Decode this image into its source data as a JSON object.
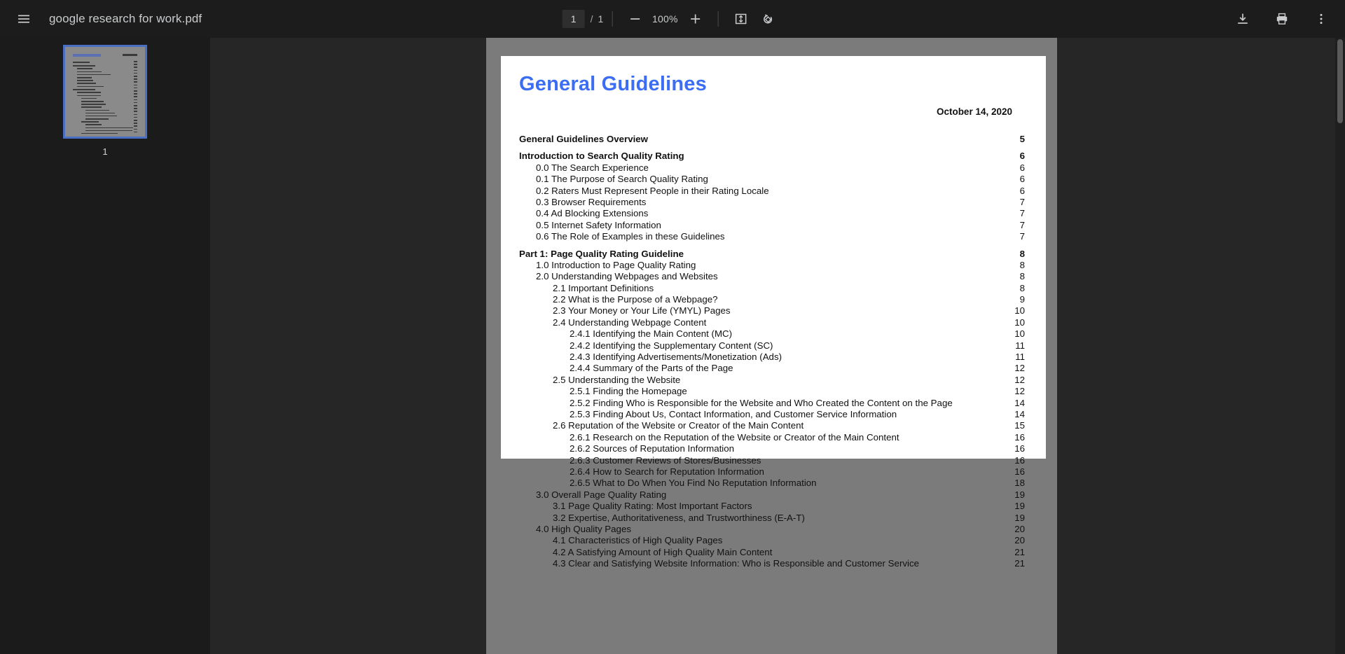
{
  "toolbar": {
    "menu_icon": "hamburger-menu-icon",
    "file_name": "google research for work.pdf",
    "page_current": "1",
    "page_separator": "/",
    "page_total": "1",
    "zoom_out_icon": "minus-icon",
    "zoom_level": "100%",
    "zoom_in_icon": "plus-icon",
    "fit_page_icon": "fit-to-page-icon",
    "rotate_icon": "rotate-counterclockwise-icon",
    "download_icon": "download-icon",
    "print_icon": "print-icon",
    "more_icon": "more-vertical-icon"
  },
  "sidebar": {
    "thumbnail_label": "1"
  },
  "document": {
    "title": "General Guidelines",
    "date": "October 14, 2020",
    "toc": [
      {
        "label": "General Guidelines Overview",
        "page": "5",
        "level": "h"
      },
      {
        "label": "Introduction to Search Quality Rating",
        "page": "6",
        "level": "h"
      },
      {
        "label": "0.0 The Search Experience",
        "page": "6",
        "level": "1"
      },
      {
        "label": "0.1 The Purpose of Search Quality Rating",
        "page": "6",
        "level": "1"
      },
      {
        "label": "0.2 Raters Must Represent People in their Rating Locale",
        "page": "6",
        "level": "1"
      },
      {
        "label": "0.3 Browser Requirements",
        "page": "7",
        "level": "1"
      },
      {
        "label": "0.4 Ad Blocking Extensions",
        "page": "7",
        "level": "1"
      },
      {
        "label": "0.5 Internet Safety Information",
        "page": "7",
        "level": "1"
      },
      {
        "label": "0.6 The Role of Examples in these Guidelines",
        "page": "7",
        "level": "1"
      },
      {
        "label": "Part 1: Page Quality Rating Guideline",
        "page": "8",
        "level": "h"
      },
      {
        "label": "1.0 Introduction to Page Quality Rating",
        "page": "8",
        "level": "1"
      },
      {
        "label": "2.0 Understanding Webpages and Websites",
        "page": "8",
        "level": "1"
      },
      {
        "label": "2.1 Important Definitions",
        "page": "8",
        "level": "2"
      },
      {
        "label": "2.2 What is the Purpose of a Webpage?",
        "page": "9",
        "level": "2"
      },
      {
        "label": "2.3 Your Money or Your Life (YMYL) Pages",
        "page": "10",
        "level": "2"
      },
      {
        "label": "2.4 Understanding Webpage Content",
        "page": "10",
        "level": "2"
      },
      {
        "label": "2.4.1 Identifying the Main Content (MC)",
        "page": "10",
        "level": "3"
      },
      {
        "label": "2.4.2 Identifying the Supplementary Content (SC)",
        "page": "11",
        "level": "3"
      },
      {
        "label": "2.4.3 Identifying Advertisements/Monetization (Ads)",
        "page": "11",
        "level": "3"
      },
      {
        "label": "2.4.4 Summary of the Parts of the Page",
        "page": "12",
        "level": "3"
      },
      {
        "label": "2.5 Understanding the Website",
        "page": "12",
        "level": "2"
      },
      {
        "label": "2.5.1 Finding the Homepage",
        "page": "12",
        "level": "3"
      },
      {
        "label": "2.5.2 Finding Who is Responsible for the Website and Who Created the Content on the Page",
        "page": "14",
        "level": "3"
      },
      {
        "label": "2.5.3 Finding About Us, Contact Information, and Customer Service Information",
        "page": "14",
        "level": "3"
      },
      {
        "label": "2.6 Reputation of the Website or Creator of the Main Content",
        "page": "15",
        "level": "2"
      },
      {
        "label": "2.6.1 Research on the Reputation of the Website or Creator of the Main Content",
        "page": "16",
        "level": "3"
      },
      {
        "label": "2.6.2 Sources of Reputation Information",
        "page": "16",
        "level": "3"
      },
      {
        "label": "2.6.3 Customer Reviews of Stores/Businesses",
        "page": "16",
        "level": "3"
      },
      {
        "label": "2.6.4 How to Search for Reputation Information",
        "page": "16",
        "level": "3"
      },
      {
        "label": "2.6.5 What to Do When You Find No Reputation Information",
        "page": "18",
        "level": "3"
      },
      {
        "label": "3.0 Overall Page Quality Rating",
        "page": "19",
        "level": "1"
      },
      {
        "label": "3.1 Page Quality Rating: Most Important Factors",
        "page": "19",
        "level": "2"
      },
      {
        "label": "3.2 Expertise, Authoritativeness, and Trustworthiness (E-A-T)",
        "page": "19",
        "level": "2"
      },
      {
        "label": "4.0 High Quality Pages",
        "page": "20",
        "level": "1"
      },
      {
        "label": "4.1 Characteristics of High Quality Pages",
        "page": "20",
        "level": "2"
      },
      {
        "label": "4.2 A Satisfying Amount of High Quality Main Content",
        "page": "21",
        "level": "2"
      },
      {
        "label": "4.3 Clear and Satisfying Website Information: Who is Responsible and Customer Service",
        "page": "21",
        "level": "2"
      }
    ]
  },
  "colors": {
    "title_blue": "#3b6ef5",
    "thumb_selected_border": "#4a6fc4",
    "toolbar_bg": "#1c1c1c",
    "viewer_bg": "#262626"
  }
}
